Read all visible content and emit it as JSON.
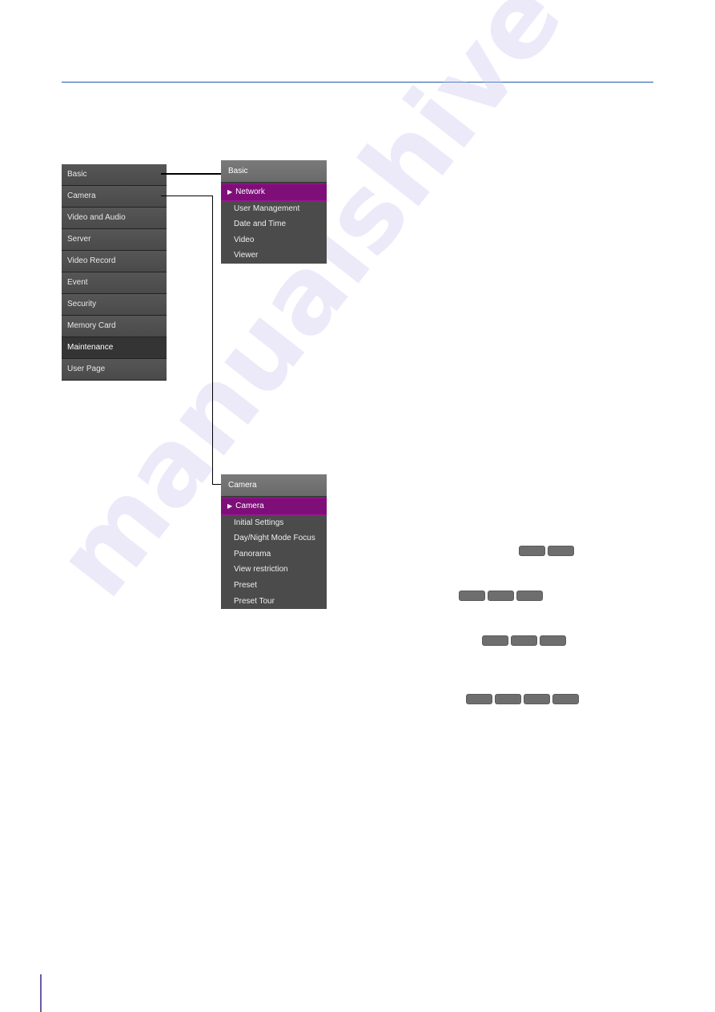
{
  "main_menu": {
    "items": [
      {
        "label": "Basic",
        "active": false
      },
      {
        "label": "Camera",
        "active": false
      },
      {
        "label": "Video and Audio",
        "active": false
      },
      {
        "label": "Server",
        "active": false
      },
      {
        "label": "Video Record",
        "active": false
      },
      {
        "label": "Event",
        "active": false
      },
      {
        "label": "Security",
        "active": false
      },
      {
        "label": "Memory Card",
        "active": false
      },
      {
        "label": "Maintenance",
        "active": true
      },
      {
        "label": "User Page",
        "active": false
      }
    ]
  },
  "basic_submenu": {
    "header": "Basic",
    "items": [
      {
        "label": "Network",
        "selected": true
      },
      {
        "label": "User Management",
        "selected": false
      },
      {
        "label": "Date and Time",
        "selected": false
      },
      {
        "label": "Video",
        "selected": false
      },
      {
        "label": "Viewer",
        "selected": false
      }
    ]
  },
  "camera_submenu": {
    "header": "Camera",
    "items": [
      {
        "label": "Camera",
        "selected": true
      },
      {
        "label": "Initial Settings",
        "selected": false
      },
      {
        "label": "Day/Night Mode Focus",
        "selected": false
      },
      {
        "label": "Panorama",
        "selected": false
      },
      {
        "label": "View restriction",
        "selected": false
      },
      {
        "label": "Preset",
        "selected": false
      },
      {
        "label": "Preset Tour",
        "selected": false
      }
    ]
  },
  "selected_arrow_icon": "▶",
  "button_chip_rows": [
    2,
    3,
    3,
    4
  ],
  "watermark": "manualshive",
  "colors": {
    "accent_purple": "#7e0f78",
    "rule_blue": "#1f5aa6",
    "menu_gray": "#4a4a4a"
  }
}
